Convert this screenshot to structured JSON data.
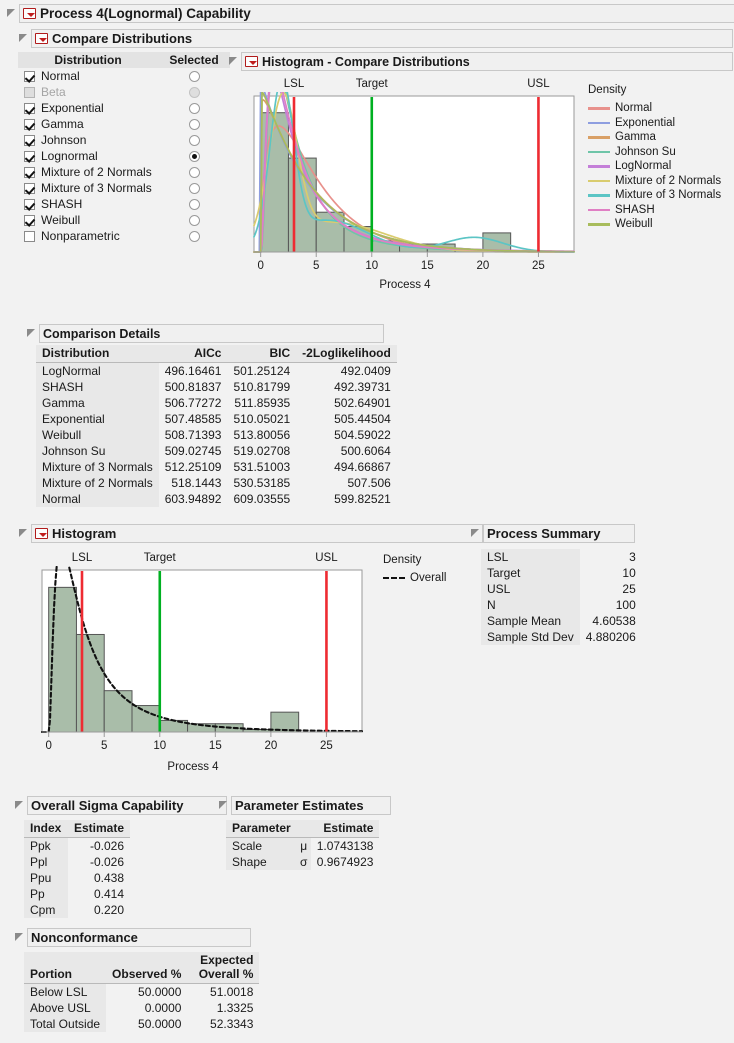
{
  "window": {
    "title": "Process 4(Lognormal) Capability"
  },
  "compare": {
    "title": "Compare Distributions",
    "col_distribution": "Distribution",
    "col_selected": "Selected",
    "items": [
      {
        "label": "Normal",
        "checked": true,
        "enabled": true,
        "selected": false
      },
      {
        "label": "Beta",
        "checked": false,
        "enabled": false,
        "selected": false
      },
      {
        "label": "Exponential",
        "checked": true,
        "enabled": true,
        "selected": false
      },
      {
        "label": "Gamma",
        "checked": true,
        "enabled": true,
        "selected": false
      },
      {
        "label": "Johnson",
        "checked": true,
        "enabled": true,
        "selected": false
      },
      {
        "label": "Lognormal",
        "checked": true,
        "enabled": true,
        "selected": true
      },
      {
        "label": "Mixture of 2 Normals",
        "checked": true,
        "enabled": true,
        "selected": false
      },
      {
        "label": "Mixture of 3 Normals",
        "checked": true,
        "enabled": true,
        "selected": false
      },
      {
        "label": "SHASH",
        "checked": true,
        "enabled": true,
        "selected": false
      },
      {
        "label": "Weibull",
        "checked": true,
        "enabled": true,
        "selected": false
      },
      {
        "label": "Nonparametric",
        "checked": false,
        "enabled": true,
        "selected": false
      }
    ]
  },
  "histogram_compare": {
    "title": "Histogram - Compare Distributions",
    "legend_title": "Density"
  },
  "histogram_overall": {
    "title": "Histogram",
    "legend_title": "Density",
    "legend_entry": "Overall"
  },
  "comparison_details": {
    "title": "Comparison Details",
    "columns": [
      "Distribution",
      "AICc",
      "BIC",
      "-2Loglikelihood"
    ],
    "rows": [
      [
        "LogNormal",
        "496.16461",
        "501.25124",
        "492.0409"
      ],
      [
        "SHASH",
        "500.81837",
        "510.81799",
        "492.39731"
      ],
      [
        "Gamma",
        "506.77272",
        "511.85935",
        "502.64901"
      ],
      [
        "Exponential",
        "507.48585",
        "510.05021",
        "505.44504"
      ],
      [
        "Weibull",
        "508.71393",
        "513.80056",
        "504.59022"
      ],
      [
        "Johnson Su",
        "509.02745",
        "519.02708",
        "500.6064"
      ],
      [
        "Mixture of 3 Normals",
        "512.25109",
        "531.51003",
        "494.66867"
      ],
      [
        "Mixture of 2 Normals",
        "518.1443",
        "530.53185",
        "507.506"
      ],
      [
        "Normal",
        "603.94892",
        "609.03555",
        "599.82521"
      ]
    ]
  },
  "process_summary": {
    "title": "Process Summary",
    "rows": [
      [
        "LSL",
        "3"
      ],
      [
        "Target",
        "10"
      ],
      [
        "USL",
        "25"
      ],
      [
        "N",
        "100"
      ],
      [
        "Sample Mean",
        "4.60538"
      ],
      [
        "Sample Std Dev",
        "4.880206"
      ]
    ]
  },
  "overall_sigma": {
    "title": "Overall Sigma Capability",
    "columns": [
      "Index",
      "Estimate"
    ],
    "rows": [
      [
        "Ppk",
        "-0.026"
      ],
      [
        "Ppl",
        "-0.026"
      ],
      [
        "Ppu",
        "0.438"
      ],
      [
        "Pp",
        "0.414"
      ],
      [
        "Cpm",
        "0.220"
      ]
    ]
  },
  "parameter_estimates": {
    "title": "Parameter Estimates",
    "columns": [
      "Parameter",
      "",
      "Estimate"
    ],
    "rows": [
      [
        "Scale",
        "μ",
        "1.0743138"
      ],
      [
        "Shape",
        "σ",
        "0.9674923"
      ]
    ]
  },
  "nonconformance": {
    "title": "Nonconformance",
    "columns": [
      "Portion",
      "Observed %",
      "Expected\nOverall %"
    ],
    "col_expected_line1": "Expected",
    "col_expected_line2": "Overall %",
    "col_portion": "Portion",
    "col_observed": "Observed %",
    "rows": [
      [
        "Below LSL",
        "50.0000",
        "51.0018"
      ],
      [
        "Above USL",
        "0.0000",
        "1.3325"
      ],
      [
        "Total Outside",
        "50.0000",
        "52.3343"
      ]
    ]
  },
  "chart_data": [
    {
      "type": "histogram",
      "id": "compare",
      "title": "Histogram - Compare Distributions",
      "xlabel": "Process 4",
      "ylabel": "Density",
      "xlim": [
        -0.6,
        28.2
      ],
      "xticks": [
        0,
        5,
        10,
        15,
        20,
        25
      ],
      "bin_width": 2.5,
      "bin_starts": [
        0,
        2.5,
        5,
        7.5,
        10,
        12.5,
        15,
        17.5,
        20,
        22.5,
        25
      ],
      "bin_heights": [
        0.175,
        0.118,
        0.05,
        0.032,
        0.014,
        0.01,
        0.01,
        0.003,
        0.024,
        0.0,
        0.0
      ],
      "bar_fill": "#a9bda9",
      "bar_stroke": "#555555",
      "reference_lines": [
        {
          "label": "LSL",
          "value": 3,
          "color": "#ee2b32"
        },
        {
          "label": "Target",
          "value": 10,
          "color": "#00b021"
        },
        {
          "label": "USL",
          "value": 25,
          "color": "#ee2b32"
        }
      ],
      "series": [
        {
          "name": "Normal",
          "color": "#e8918c"
        },
        {
          "name": "Exponential",
          "color": "#8e9ee0"
        },
        {
          "name": "Gamma",
          "color": "#d9a066"
        },
        {
          "name": "Johnson Su",
          "color": "#6ec5a8"
        },
        {
          "name": "LogNormal",
          "color": "#c47fd8"
        },
        {
          "name": "Mixture of 2 Normals",
          "color": "#d9cc6e"
        },
        {
          "name": "Mixture of 3 Normals",
          "color": "#5cc5c5"
        },
        {
          "name": "SHASH",
          "color": "#e07fc4"
        },
        {
          "name": "Weibull",
          "color": "#a8bc5c"
        }
      ]
    },
    {
      "type": "histogram",
      "id": "overall",
      "title": "Histogram",
      "xlabel": "Process 4",
      "ylabel": "Density",
      "xlim": [
        -0.6,
        28.2
      ],
      "xticks": [
        0,
        5,
        10,
        15,
        20,
        25
      ],
      "bin_width": 2.5,
      "bin_heights": [
        0.175,
        0.118,
        0.05,
        0.032,
        0.014,
        0.01,
        0.01,
        0.003,
        0.024,
        0.0,
        0.0
      ],
      "bar_fill": "#a9bda9",
      "bar_stroke": "#555555",
      "reference_lines": [
        {
          "label": "LSL",
          "value": 3,
          "color": "#ee2b32"
        },
        {
          "label": "Target",
          "value": 10,
          "color": "#00b021"
        },
        {
          "label": "USL",
          "value": 25,
          "color": "#ee2b32"
        }
      ],
      "series": [
        {
          "name": "Overall",
          "color": "#111111",
          "style": "dashed"
        }
      ]
    }
  ]
}
